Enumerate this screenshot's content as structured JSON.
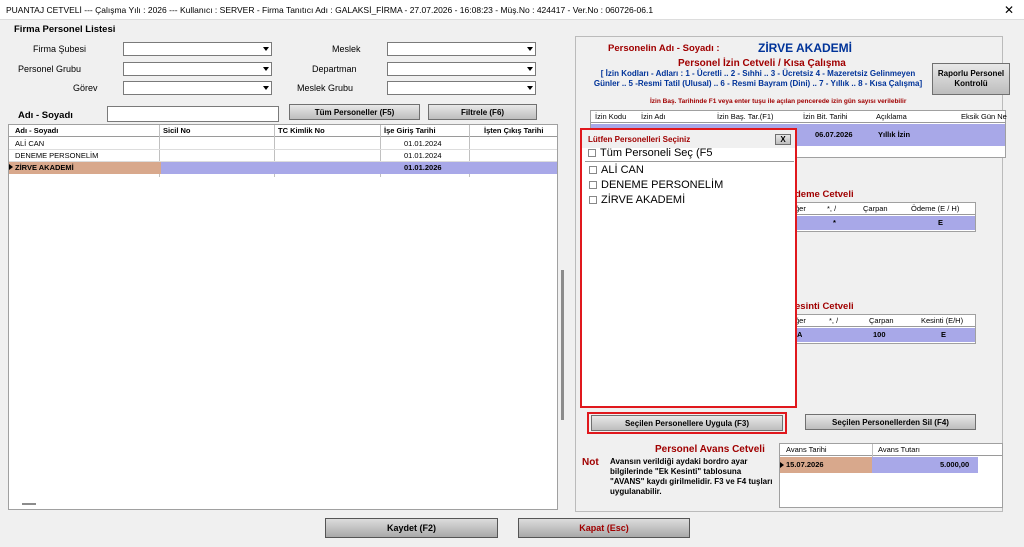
{
  "titlebar": {
    "text": "PUANTAJ CETVELİ  ---  Çalışma Yılı : 2026  ---  Kullanıcı : SERVER - Firma Tanıtıcı Adı : GALAKSİ_FİRMA - 27.07.2026 - 16:08:23 - Müş.No : 424417 - Ver.No : 060726-06.1",
    "close": "✕"
  },
  "left": {
    "section_title": "Firma Personel Listesi",
    "filters": {
      "firma_subesi": "Firma Şubesi",
      "meslek": "Meslek",
      "personel_grubu": "Personel Grubu",
      "departman": "Departman",
      "gorev": "Görev",
      "meslek_grubu": "Meslek Grubu"
    },
    "name_label": "Adı - Soyadı",
    "btn_all": "Tüm Personeller (F5)",
    "btn_filter": "Filtrele (F6)",
    "columns": [
      "Adı - Soyadı",
      "Sicil No",
      "TC Kimlik No",
      "İşe Giriş Tarihi",
      "İşten Çıkış Tarihi"
    ],
    "rows": [
      {
        "name": "ALİ CAN",
        "date": "01.01.2024"
      },
      {
        "name": "DENEME PERSONELİM",
        "date": "01.01.2024"
      },
      {
        "name": "ZİRVE  AKADEMİ",
        "date": "01.01.2026",
        "selected": true
      }
    ]
  },
  "right": {
    "person_label": "Personelin Adı - Soyadı :",
    "person_name": "ZİRVE  AKADEMİ",
    "izin_title": "Personel İzin Cetveli / Kısa Çalışma",
    "izin_codes": "[ İzin Kodları - Adları : 1 - Ücretli .. 2 - Sıhhi  .. 3 - Ücretsiz  4 - Mazeretsiz Gelinmeyen Günler .. 5 -Resmi Tatil (Ulusal) .. 6 - Resmi Bayram (Dini) .. 7 - Yıllık .. 8 - Kısa Çalışma]",
    "izin_hint": "İzin Baş. Tarihinde F1 veya enter tuşu ile açılan pencerede izin gün sayısı verilebilir",
    "btn_rapor": "Raporlu Personel Kontrolü",
    "izin_columns": [
      "İzin Kodu",
      "İzin Adı",
      "İzin Baş. Tar.(F1)",
      "İzin Bit. Tarihi",
      "Açıklama",
      "Eksik Gün Ne"
    ],
    "izin_row": {
      "bit": "06.07.2026",
      "aciklama": "Yıllık İzin"
    },
    "odeme_title": "deme Cetveli",
    "odeme_columns": [
      "ğer",
      "*, /",
      "Çarpan",
      "Ödeme (E / H)"
    ],
    "odeme_row": {
      "op": "*",
      "val": "E"
    },
    "kesinti_title": "esinti Cetveli",
    "kesinti_columns": [
      "ğer",
      "*, /",
      "Çarpan",
      "Kesinti (E/H)"
    ],
    "kesinti_row": {
      "a": "A",
      "carpan": "100",
      "val": "E"
    },
    "btn_apply": "Seçilen Personellere Uygula (F3)",
    "btn_delete": "Seçilen Personellerden Sil (F4)",
    "avans_title": "Personel Avans Cetveli",
    "not_label": "Not",
    "not_text": "Avansın verildiği aydaki bordro ayar bilgilerinde \"Ek Kesinti\" tablosuna \"AVANS\" kaydı girilmelidir. F3 ve F4 tuşları uygulanabilir.",
    "avans_columns": [
      "Avans Tarihi",
      "Avans Tutarı"
    ],
    "avans_row": {
      "tarih": "15.07.2026",
      "tutar": "5.000,00"
    }
  },
  "popup": {
    "title": "Lütfen Personelleri Seçiniz",
    "close": "X",
    "select_all": "Tüm Personeli Seç (F5",
    "items": [
      "ALİ CAN",
      "DENEME PERSONELİM",
      "ZİRVE  AKADEMİ"
    ]
  },
  "footer": {
    "save": "Kaydet (F2)",
    "close": "Kapat (Esc)"
  }
}
